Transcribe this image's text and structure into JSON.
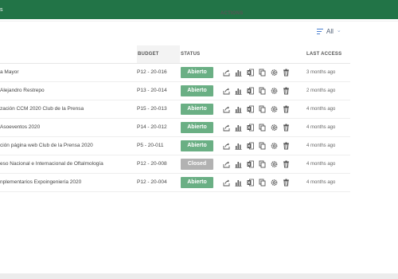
{
  "header": {
    "brand_fragment": "s"
  },
  "filter": {
    "label": "All",
    "icon": "filter-lines-icon",
    "chevron": "chevron-down-icon"
  },
  "columns": {
    "budget": "BUDGET",
    "status": "STATUS",
    "actions": "ACTIONS",
    "last_access": "LAST ACCESS"
  },
  "colors": {
    "brand_green": "#227447",
    "status_open": "#6aaf84",
    "status_closed": "#b2b2b2",
    "filter_accent": "#4a7fd0"
  },
  "action_icons": [
    "share-icon",
    "bar-chart-icon",
    "excel-icon",
    "copy-icon",
    "settings-icon",
    "trash-icon"
  ],
  "rows": [
    {
      "name": "a Mayor",
      "code": "P12 - 20-016",
      "status": "Abierto",
      "status_kind": "open",
      "last_access": "3 months ago"
    },
    {
      "name": "Alejandro Restrepo",
      "code": "P13 - 20-014",
      "status": "Abierto",
      "status_kind": "open",
      "last_access": "2 months ago"
    },
    {
      "name": "zación CCM 2020 Club de la Prensa",
      "code": "P15 - 20-013",
      "status": "Abierto",
      "status_kind": "open",
      "last_access": "4 months ago"
    },
    {
      "name": "Asoeventos 2020",
      "code": "P14 - 20-012",
      "status": "Abierto",
      "status_kind": "open",
      "last_access": "4 months ago"
    },
    {
      "name": "ción página web Club de la Prensa 2020",
      "code": "P5 - 20-011",
      "status": "Abierto",
      "status_kind": "open",
      "last_access": "4 months ago"
    },
    {
      "name": "eso Nacional e Internacional de Oftalmología",
      "code": "P12 - 20-008",
      "status": "Closed",
      "status_kind": "closed",
      "last_access": "4 months ago"
    },
    {
      "name": "nplementarios Expoingeniería 2020",
      "code": "P12 - 20-004",
      "status": "Abierto",
      "status_kind": "open",
      "last_access": "4 months ago"
    }
  ]
}
